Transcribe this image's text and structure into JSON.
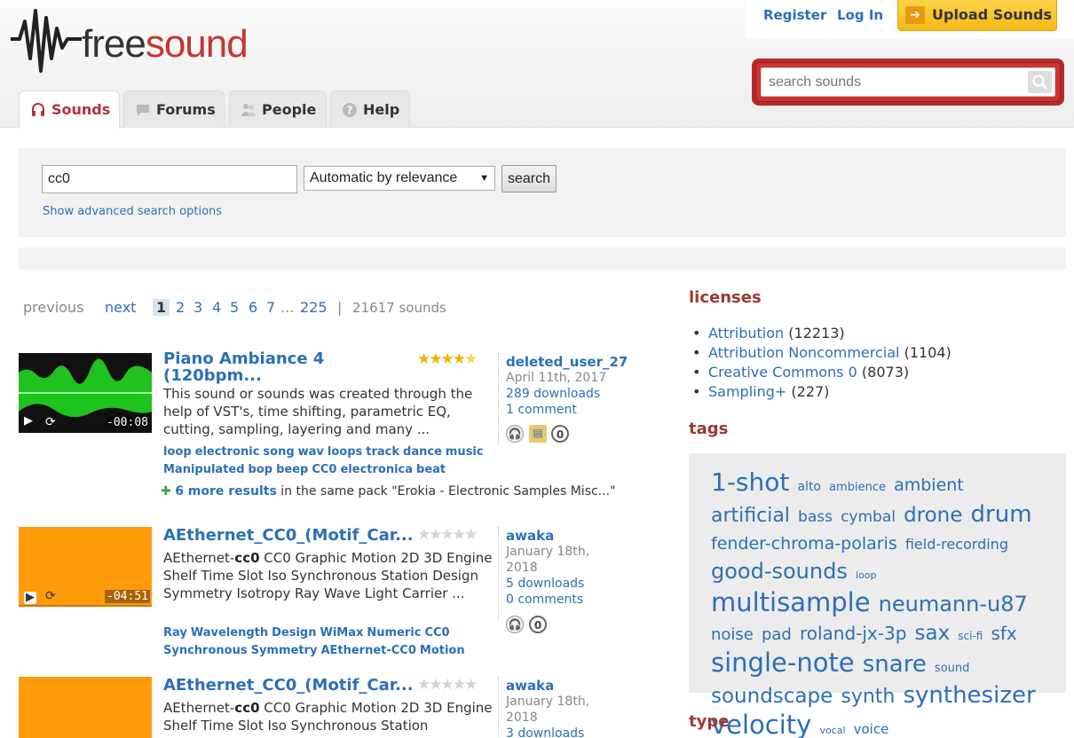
{
  "header": {
    "logo_text_1": "free",
    "logo_text_2": "sound",
    "register": "Register",
    "login": "Log In",
    "upload": "Upload Sounds",
    "search_placeholder": "search sounds",
    "brand_color": "#c6352f"
  },
  "tabs": [
    {
      "label": "Sounds",
      "icon": "headphones-icon",
      "active": true
    },
    {
      "label": "Forums",
      "icon": "speech-bubble-icon"
    },
    {
      "label": "People",
      "icon": "people-icon"
    },
    {
      "label": "Help",
      "icon": "question-icon"
    }
  ],
  "search": {
    "query": "cc0",
    "sort": "Automatic by relevance",
    "button": "search",
    "advanced": "Show advanced search options"
  },
  "pagination": {
    "previous": "previous",
    "next": "next",
    "pages": [
      "1",
      "2",
      "3",
      "4",
      "5",
      "6",
      "7"
    ],
    "ellipsis": "...",
    "last": "225",
    "separator": "|",
    "count": "21617 sounds"
  },
  "results": [
    {
      "title": "Piano Ambiance 4 (120bpm...",
      "rating": 4.5,
      "duration": "-00:08",
      "desc": "This sound or sounds was created through the help of VST's, time shifting, parametric EQ, cutting, sampling, layering and many ...",
      "tags": [
        "loop",
        "electronic",
        "song",
        "wav",
        "loops",
        "track",
        "dance",
        "music",
        "Manipulated",
        "bop",
        "beep",
        "CC0",
        "electronica",
        "beat"
      ],
      "user": "deleted_user_27",
      "date": "April 11th, 2017",
      "downloads": "289 downloads",
      "comments": "1 comment",
      "more_count": "6 more results",
      "more_text": "in the same pack \"Erokia - Electronic Samples Misc...\""
    },
    {
      "title": "AEthernet_CC0_(Motif_Car...",
      "rating": 0,
      "duration": "-04:51",
      "desc_pre": "AEthernet-",
      "desc_bold": "cc0",
      "desc_post": " CC0 Graphic Motion 2D 3D Engine Shelf Time Slot Iso Synchronous Station Design Symmetry Isotropy Ray Wave Light Carrier ...",
      "tags": [
        "Ray",
        "Wavelength",
        "Design",
        "WiMax",
        "Numeric",
        "CC0",
        "Synchronous",
        "Symmetry",
        "AEthernet-CC0",
        "Motion"
      ],
      "user": "awaka",
      "date": "January 18th, 2018",
      "downloads": "5 downloads",
      "comments": "0 comments"
    },
    {
      "title": "AEthernet_CC0_(Motif_Car...",
      "rating": 0,
      "desc_pre": "AEthernet-",
      "desc_bold": "cc0",
      "desc_post": " CC0 Graphic Motion 2D 3D Engine Shelf Time Slot Iso Synchronous Station",
      "user": "awaka",
      "date": "January 18th, 2018",
      "downloads": "3 downloads"
    }
  ],
  "sidebar": {
    "licenses_title": "licenses",
    "licenses": [
      {
        "name": "Attribution",
        "count": "(12213)"
      },
      {
        "name": "Attribution Noncommercial",
        "count": "(1104)"
      },
      {
        "name": "Creative Commons 0",
        "count": "(8073)"
      },
      {
        "name": "Sampling+",
        "count": "(227)"
      }
    ],
    "tags_title": "tags",
    "tags": [
      {
        "t": "1-shot",
        "s": 28
      },
      {
        "t": "alto",
        "s": 14
      },
      {
        "t": "ambience",
        "s": 13
      },
      {
        "t": "ambient",
        "s": 19
      },
      {
        "t": "artificial",
        "s": 22
      },
      {
        "t": "bass",
        "s": 17
      },
      {
        "t": "cymbal",
        "s": 17
      },
      {
        "t": "drone",
        "s": 23
      },
      {
        "t": "drum",
        "s": 26
      },
      {
        "t": "fender-chroma-polaris",
        "s": 19
      },
      {
        "t": "field-recording",
        "s": 16
      },
      {
        "t": "good-sounds",
        "s": 24
      },
      {
        "t": "loop",
        "s": 11
      },
      {
        "t": "multisample",
        "s": 29
      },
      {
        "t": "neumann-u87",
        "s": 24
      },
      {
        "t": "noise",
        "s": 18
      },
      {
        "t": "pad",
        "s": 18
      },
      {
        "t": "roland-jx-3p",
        "s": 20
      },
      {
        "t": "sax",
        "s": 23
      },
      {
        "t": "sci-fi",
        "s": 12
      },
      {
        "t": "sfx",
        "s": 20
      },
      {
        "t": "single-note",
        "s": 29
      },
      {
        "t": "snare",
        "s": 26
      },
      {
        "t": "sound",
        "s": 13
      },
      {
        "t": "soundscape",
        "s": 23
      },
      {
        "t": "synth",
        "s": 22
      },
      {
        "t": "synthesizer",
        "s": 26
      },
      {
        "t": "velocity",
        "s": 29
      },
      {
        "t": "vocal",
        "s": 11
      },
      {
        "t": "voice",
        "s": 15
      }
    ],
    "type_title": "type"
  }
}
